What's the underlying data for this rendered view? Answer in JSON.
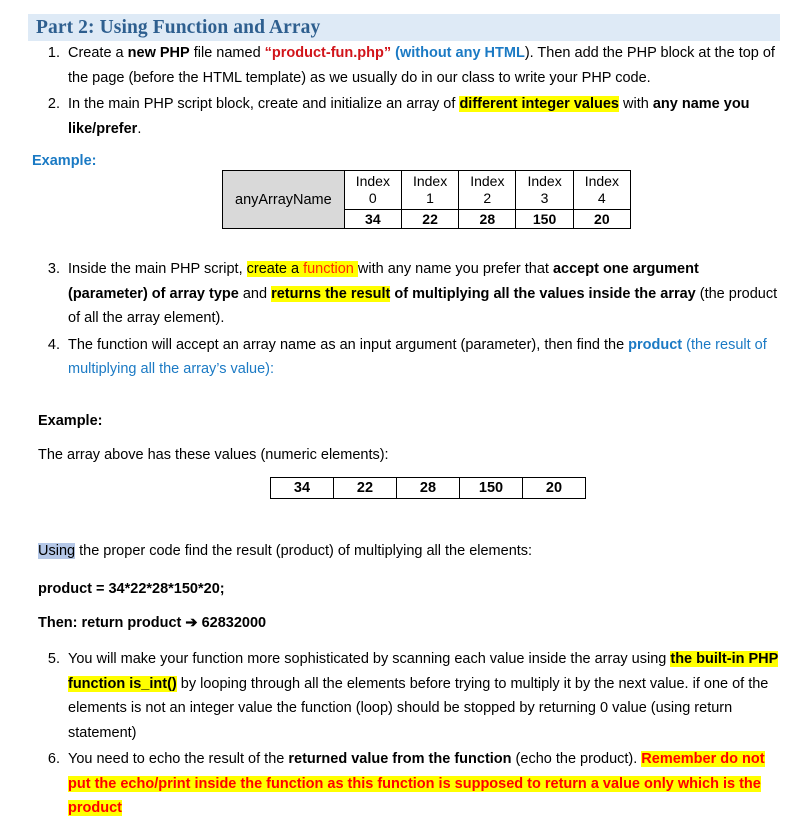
{
  "header": {
    "title": "Part 2: Using Function and Array",
    "bg_color": "#deeaf6",
    "text_color": "#2e5f8f"
  },
  "steps_top": [
    {
      "number": "1.",
      "parts": [
        {
          "text": "Create a ",
          "style": "normal"
        },
        {
          "text": "new PHP",
          "style": "bold"
        },
        {
          "text": " file named ",
          "style": "normal"
        },
        {
          "text": "“product-fun.php”",
          "style": "red-bold"
        },
        {
          "text": " ",
          "style": "normal"
        },
        {
          "text": "(without any HTML",
          "style": "blue-bold"
        },
        {
          "text": "). Then add the PHP block at the top of the page (before the HTML template) as we usually do in our class to write your PHP code.",
          "style": "normal"
        }
      ]
    },
    {
      "number": "2.",
      "parts": [
        {
          "text": "In the main PHP script block, create and initialize an array of ",
          "style": "normal"
        },
        {
          "text": "different integer values",
          "style": "highlight-bold"
        },
        {
          "text": " with ",
          "style": "normal"
        },
        {
          "text": "any name you like/prefer",
          "style": "bold"
        },
        {
          "text": ".",
          "style": "normal"
        }
      ]
    }
  ],
  "example_label_1": "Example:",
  "array_table": {
    "name": "anyArrayName",
    "index_label": "Index",
    "indices": [
      "0",
      "1",
      "2",
      "3",
      "4"
    ],
    "values": [
      "34",
      "22",
      "28",
      "150",
      "20"
    ]
  },
  "steps_mid": [
    {
      "number": "3.",
      "parts": [
        {
          "text": "Inside the main PHP script, ",
          "style": "normal"
        },
        {
          "text": "create a ",
          "style": "highlight"
        },
        {
          "text": "function",
          "style": "highlight-orange"
        },
        {
          "text": " ",
          "style": "highlight"
        },
        {
          "text": "with any name you prefer that ",
          "style": "normal"
        },
        {
          "text": "accept one argument (parameter) of array type",
          "style": "bold"
        },
        {
          "text": " and ",
          "style": "normal"
        },
        {
          "text": "returns the result",
          "style": "highlight-bold"
        },
        {
          "text": " ",
          "style": "normal"
        },
        {
          "text": "of multiplying all the values inside the array",
          "style": "bold"
        },
        {
          "text": " (the product of all the array element).",
          "style": "normal"
        }
      ]
    },
    {
      "number": "4.",
      "parts": [
        {
          "text": "The function will accept an array name as an input argument (parameter), then find the ",
          "style": "normal"
        },
        {
          "text": "product",
          "style": "blue-bold"
        },
        {
          "text": " (the result of multiplying all the array’s value):",
          "style": "blue"
        }
      ]
    }
  ],
  "example_label_2": "Example:",
  "array_values_intro": "The array above has these values (numeric elements):",
  "values_table": {
    "values": [
      "34",
      "22",
      "28",
      "150",
      "20"
    ]
  },
  "using_line": {
    "highlighted_word": "Using",
    "rest": " the proper code find the result (product) of multiplying all the elements:"
  },
  "product_line": "product = 34*22*28*150*20;",
  "then_line": {
    "prefix": "Then: return product ",
    "arrow": "➔",
    "result": " 62832000"
  },
  "steps_bottom": [
    {
      "number": "5.",
      "parts": [
        {
          "text": "You will make your function more sophisticated by scanning each value inside the array using ",
          "style": "normal"
        },
        {
          "text": "the built-in PHP function is_int()",
          "style": "highlight-bold"
        },
        {
          "text": " by looping through all the elements before trying to multiply it by the next value. if one of the elements is not an integer value the function (loop) should be stopped by returning 0 value (using return statement)",
          "style": "normal"
        }
      ]
    },
    {
      "number": "6.",
      "parts": [
        {
          "text": "You need to echo the result of the ",
          "style": "normal"
        },
        {
          "text": "returned value from the function",
          "style": "bold"
        },
        {
          "text": " (echo the product). ",
          "style": "normal"
        },
        {
          "text": "Remember do not put the echo/print inside the function as this function is supposed to return a value only which is the product",
          "style": "highlight-red"
        }
      ]
    }
  ],
  "colors": {
    "highlight_yellow": "#ffff00",
    "selection_blue": "#b4c7e7",
    "red": "#ff0000",
    "link_blue": "#1b7ac4",
    "table_gray": "#d9d9d9"
  }
}
